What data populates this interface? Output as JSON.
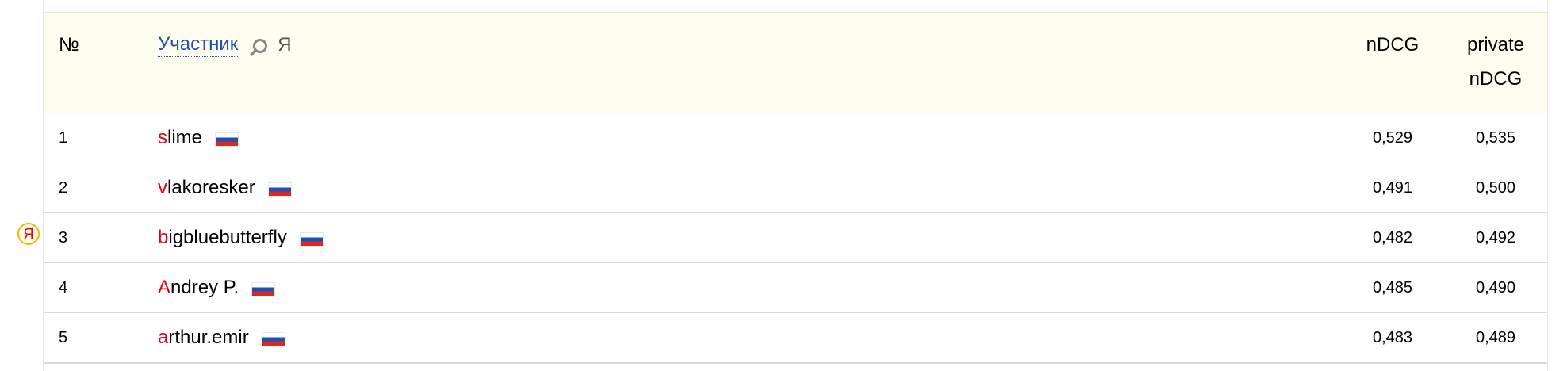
{
  "header": {
    "num": "№",
    "participant": "Участник",
    "ya_filter": "Я",
    "ndcg": "nDCG",
    "private_line1": "private",
    "private_line2": "nDCG"
  },
  "badge": "Я",
  "rows": [
    {
      "rank": "1",
      "first": "s",
      "rest": "lime",
      "flag": "russia-flag-icon",
      "ndcg": "0,529",
      "private": "0,535"
    },
    {
      "rank": "2",
      "first": "v",
      "rest": "lakoresker",
      "flag": "russia-flag-icon",
      "ndcg": "0,491",
      "private": "0,500"
    },
    {
      "rank": "3",
      "first": "b",
      "rest": "igbluebutterfly",
      "flag": "russia-flag-icon",
      "ndcg": "0,482",
      "private": "0,492"
    },
    {
      "rank": "4",
      "first": "A",
      "rest": "ndrey P.",
      "flag": "russia-flag-icon",
      "ndcg": "0,485",
      "private": "0,490"
    },
    {
      "rank": "5",
      "first": "a",
      "rest": "rthur.emir",
      "flag": "russia-flag-icon",
      "ndcg": "0,483",
      "private": "0,489"
    }
  ],
  "colors": {
    "header_bg": "#fefdf0",
    "link": "#1f4fb2",
    "first_letter": "#e0000f",
    "badge_ring": "#f5b800"
  }
}
